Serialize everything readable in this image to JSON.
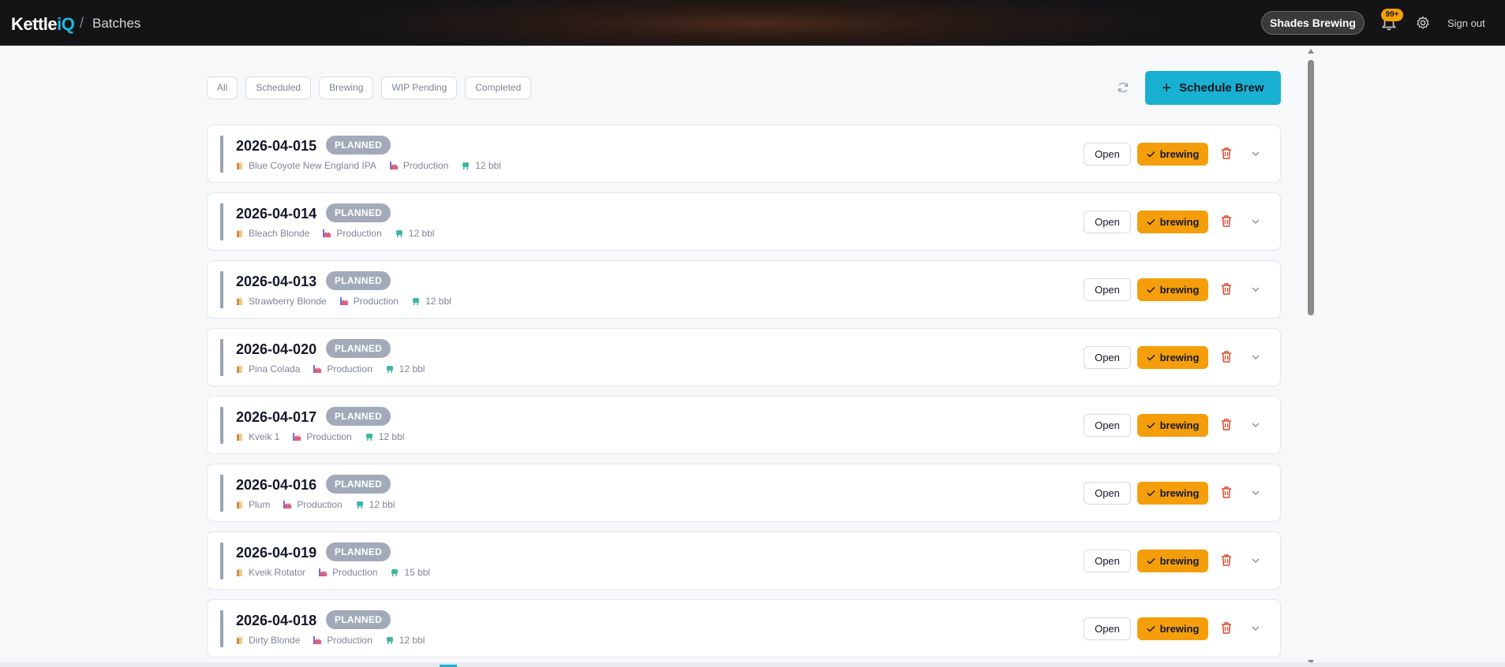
{
  "header": {
    "brand_main": "Kettle",
    "brand_accent": "iQ",
    "separator": "/",
    "breadcrumb": "Batches",
    "org": "Shades Brewing",
    "notifications_badge": "99+",
    "signout": "Sign out"
  },
  "filters": [
    "All",
    "Scheduled",
    "Brewing",
    "WIP Pending",
    "Completed"
  ],
  "actions": {
    "schedule_label": "Schedule Brew",
    "schedule_icon": "+"
  },
  "row_actions": {
    "open": "Open",
    "brew": "brewing"
  },
  "icons": {
    "beer": "beer-icon",
    "factory": "factory-icon",
    "tank": "tank-icon",
    "trash": "trash-icon",
    "chevron": "chevron-down-icon",
    "check": "check-icon"
  },
  "colors": {
    "accent": "#1ab0d2",
    "brew": "#f59e0b",
    "status_planned": "#a2aaba",
    "delete": "#e04a2f"
  },
  "batches": [
    {
      "id": "2026-04-015",
      "status": "PLANNED",
      "recipe": "Blue Coyote New England IPA",
      "type": "Production",
      "size": "12 bbl"
    },
    {
      "id": "2026-04-014",
      "status": "PLANNED",
      "recipe": "Bleach Blonde",
      "type": "Production",
      "size": "12 bbl"
    },
    {
      "id": "2026-04-013",
      "status": "PLANNED",
      "recipe": "Strawberry Blonde",
      "type": "Production",
      "size": "12 bbl"
    },
    {
      "id": "2026-04-020",
      "status": "PLANNED",
      "recipe": "Pina Colada",
      "type": "Production",
      "size": "12 bbl"
    },
    {
      "id": "2026-04-017",
      "status": "PLANNED",
      "recipe": "Kveik 1",
      "type": "Production",
      "size": "12 bbl"
    },
    {
      "id": "2026-04-016",
      "status": "PLANNED",
      "recipe": "Plum",
      "type": "Production",
      "size": "12 bbl"
    },
    {
      "id": "2026-04-019",
      "status": "PLANNED",
      "recipe": "Kveik Rotator",
      "type": "Production",
      "size": "15 bbl"
    },
    {
      "id": "2026-04-018",
      "status": "PLANNED",
      "recipe": "Dirty Blonde",
      "type": "Production",
      "size": "12 bbl"
    }
  ]
}
